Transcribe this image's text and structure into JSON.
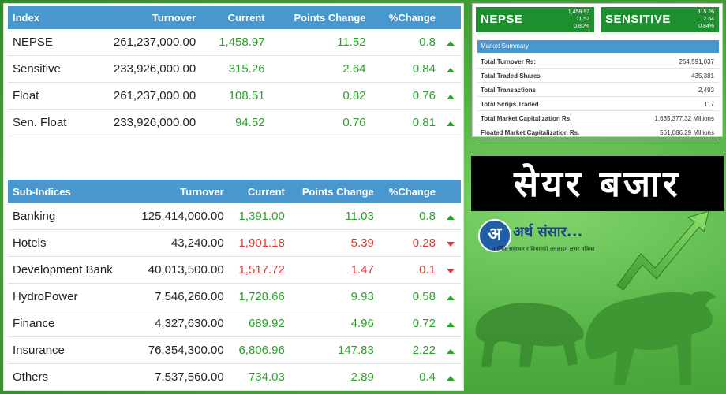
{
  "index_table": {
    "headers": [
      "Index",
      "Turnover",
      "Current",
      "Points Change",
      "%Change"
    ],
    "rows": [
      {
        "name": "NEPSE",
        "turnover": "261,237,000.00",
        "current": "1,458.97",
        "points": "11.52",
        "pct": "0.8",
        "dir": "up"
      },
      {
        "name": "Sensitive",
        "turnover": "233,926,000.00",
        "current": "315.26",
        "points": "2.64",
        "pct": "0.84",
        "dir": "up"
      },
      {
        "name": "Float",
        "turnover": "261,237,000.00",
        "current": "108.51",
        "points": "0.82",
        "pct": "0.76",
        "dir": "up"
      },
      {
        "name": "Sen. Float",
        "turnover": "233,926,000.00",
        "current": "94.52",
        "points": "0.76",
        "pct": "0.81",
        "dir": "up"
      }
    ]
  },
  "sub_table": {
    "headers": [
      "Sub-Indices",
      "Turnover",
      "Current",
      "Points Change",
      "%Change"
    ],
    "rows": [
      {
        "name": "Banking",
        "turnover": "125,414,000.00",
        "current": "1,391.00",
        "points": "11.03",
        "pct": "0.8",
        "dir": "up"
      },
      {
        "name": "Hotels",
        "turnover": "43,240.00",
        "current": "1,901.18",
        "points": "5.39",
        "pct": "0.28",
        "dir": "down"
      },
      {
        "name": "Development Bank",
        "turnover": "40,013,500.00",
        "current": "1,517.72",
        "points": "1.47",
        "pct": "0.1",
        "dir": "down"
      },
      {
        "name": "HydroPower",
        "turnover": "7,546,260.00",
        "current": "1,728.66",
        "points": "9.93",
        "pct": "0.58",
        "dir": "up"
      },
      {
        "name": "Finance",
        "turnover": "4,327,630.00",
        "current": "689.92",
        "points": "4.96",
        "pct": "0.72",
        "dir": "up"
      },
      {
        "name": "Insurance",
        "turnover": "76,354,300.00",
        "current": "6,806.96",
        "points": "147.83",
        "pct": "2.22",
        "dir": "up"
      },
      {
        "name": "Others",
        "turnover": "7,537,560.00",
        "current": "734.03",
        "points": "2.89",
        "pct": "0.4",
        "dir": "up"
      }
    ]
  },
  "summary_boxes": [
    {
      "name": "NEPSE",
      "v1": "1,458.97",
      "v2": "11.52",
      "v3": "0.80%"
    },
    {
      "name": "SENSITIVE",
      "v1": "315.26",
      "v2": "2.64",
      "v3": "0.84%"
    }
  ],
  "market_summary": {
    "title": "Market Summary",
    "rows": [
      {
        "k": "Total Turnover Rs:",
        "v": "264,591,037"
      },
      {
        "k": "Total Traded Shares",
        "v": "435,381"
      },
      {
        "k": "Total Transactions",
        "v": "2,493"
      },
      {
        "k": "Total Scrips Traded",
        "v": "117"
      },
      {
        "k": "Total Market Capitalization Rs.",
        "v": "1,635,377.32 Millions"
      },
      {
        "k": "Floated Market Capitalization Rs.",
        "v": "561,086.29 Millions"
      }
    ]
  },
  "banner": {
    "text": "सेयर बजार"
  },
  "logo": {
    "letter": "अ",
    "name": "अर्थ संसार...",
    "tagline": "आर्थिक समाचार र विचारको अनलाइन लभर पत्रिका"
  },
  "colors": {
    "header_blue": "#4a97cf",
    "up_green": "#2aa22a",
    "down_red": "#e03535",
    "box_green": "#1e8f2f"
  }
}
